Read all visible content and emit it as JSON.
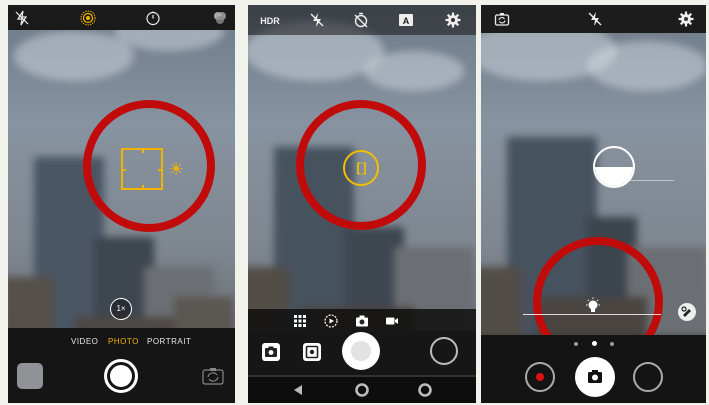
{
  "panel1": {
    "top_icons": [
      "flash-off-icon",
      "live-photo-icon",
      "timer-icon",
      "filters-icon"
    ],
    "zoom_label": "1×",
    "modes": [
      {
        "label": "VIDEO",
        "active": false
      },
      {
        "label": "PHOTO",
        "active": true
      },
      {
        "label": "PORTRAIT",
        "active": false
      }
    ],
    "accent_color": "#f0b400"
  },
  "panel2": {
    "top_labels": {
      "hdr": "HDR"
    },
    "top_icons": [
      "flash-off-icon",
      "timer-off-icon",
      "auto-icon",
      "settings-icon"
    ],
    "focus_symbol": "[ ]",
    "mode_icons": [
      "grid-icon",
      "slow-motion-icon",
      "camera-icon",
      "video-icon"
    ],
    "bottom_icons": [
      "switch-camera-icon",
      "gallery-icon",
      "shutter-icon",
      "mode-icon"
    ],
    "nav_icons": [
      "back-icon",
      "home-icon",
      "recents-icon"
    ]
  },
  "panel3": {
    "top_icons": [
      "switch-camera-icon",
      "flash-off-icon",
      "settings-icon"
    ],
    "exposure_indicator": "half-filled-exposure-icon",
    "slider_icon": "lightbulb-icon",
    "page_dots": 3,
    "active_dot": 2,
    "bottom_icons": [
      "record-icon",
      "camera-shutter-icon",
      "empty-circle-icon"
    ]
  },
  "highlight_color": "#c10b0b"
}
